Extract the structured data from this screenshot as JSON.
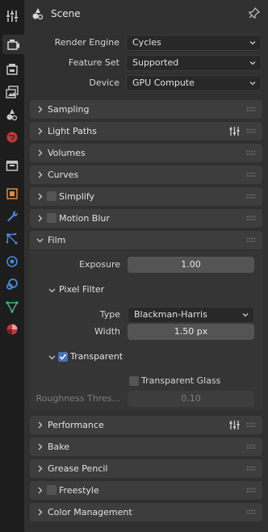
{
  "header": {
    "title": "Scene"
  },
  "render": {
    "engine_label": "Render Engine",
    "engine_value": "Cycles",
    "feature_label": "Feature Set",
    "feature_value": "Supported",
    "device_label": "Device",
    "device_value": "GPU Compute"
  },
  "panels": {
    "sampling": "Sampling",
    "light_paths": "Light Paths",
    "volumes": "Volumes",
    "curves": "Curves",
    "simplify": "Simplify",
    "motion_blur": "Motion Blur",
    "film": "Film",
    "performance": "Performance",
    "bake": "Bake",
    "grease_pencil": "Grease Pencil",
    "freestyle": "Freestyle",
    "color_management": "Color Management"
  },
  "film": {
    "exposure_label": "Exposure",
    "exposure_value": "1.00",
    "pixel_filter": {
      "title": "Pixel Filter",
      "type_label": "Type",
      "type_value": "Blackman-Harris",
      "width_label": "Width",
      "width_value": "1.50 px"
    },
    "transparent": {
      "title": "Transparent",
      "checked": true,
      "glass_label": "Transparent Glass",
      "glass_checked": false,
      "roughness_label": "Roughness Thres...",
      "roughness_value": "0.10"
    }
  },
  "colors": {
    "accent": "#4772b3",
    "panel": "#3d3d3d",
    "background": "#303030",
    "tabstrip": "#1d1d1d"
  },
  "tabs": [
    "tool-icon",
    "render-icon",
    "output-icon",
    "view-layer-icon",
    "scene-icon",
    "world-icon",
    "collection-icon",
    "object-icon",
    "modifier-icon",
    "particles-icon",
    "physics-icon",
    "constraints-icon",
    "data-icon",
    "material-icon"
  ]
}
